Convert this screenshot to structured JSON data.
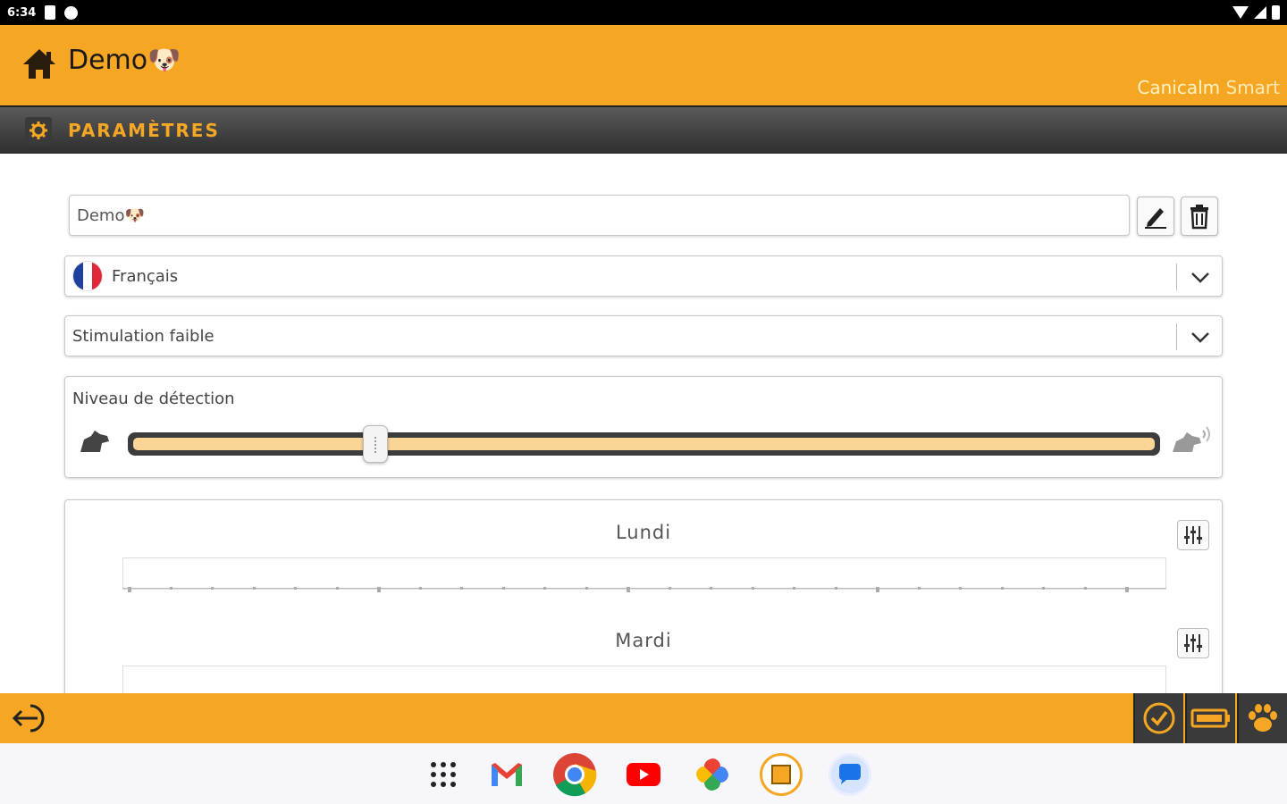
{
  "status_bar": {
    "time": "6:34"
  },
  "header": {
    "title": "Demo🐶",
    "brand_part1": "Canicalm",
    "brand_part2": "Smart"
  },
  "section": {
    "title": "PARAMÈTRES"
  },
  "name_field": {
    "value": "Demo🐶"
  },
  "language_select": {
    "selected": "Français"
  },
  "mode_select": {
    "selected": "Stimulation faible"
  },
  "detection": {
    "label": "Niveau de détection",
    "level": 0.24
  },
  "schedule": {
    "days": [
      {
        "label": "Lundi"
      },
      {
        "label": "Mardi"
      }
    ]
  },
  "colors": {
    "accent": "#f5a623",
    "dark": "#3a3a3a",
    "slider_fill": "#fbd596"
  },
  "icons": [
    "home-icon",
    "gear-icon",
    "edit-icon",
    "trash-icon",
    "chevron-down-icon",
    "dog-quiet-icon",
    "dog-barking-icon",
    "sliders-icon",
    "exit-icon",
    "check-icon",
    "battery-icon",
    "paw-icon"
  ],
  "dock": [
    "apps-icon",
    "gmail-icon",
    "chrome-icon",
    "youtube-icon",
    "photos-icon",
    "canicalm-icon",
    "messages-icon"
  ]
}
